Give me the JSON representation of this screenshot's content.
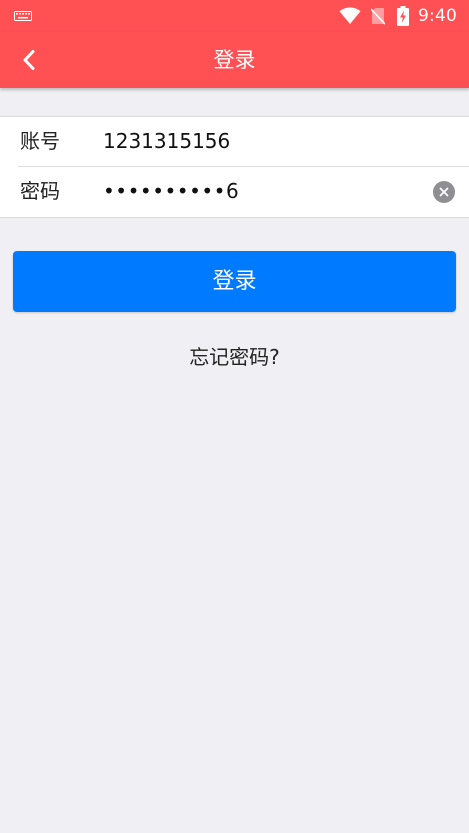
{
  "status_bar": {
    "time": "9:40",
    "icons": [
      "keyboard-icon",
      "wifi-icon",
      "no-sim-icon",
      "battery-charging-icon"
    ]
  },
  "app_bar": {
    "back_icon": "chevron-left-icon",
    "title": "登录"
  },
  "form": {
    "account": {
      "label": "账号",
      "value": "1231315156"
    },
    "password": {
      "label": "密码",
      "value": "••••••••••6",
      "clear_icon": "clear-icon"
    }
  },
  "login_button": {
    "label": "登录"
  },
  "forgot_password": {
    "label": "忘记密码?"
  },
  "colors": {
    "header": "#ff5054",
    "primary_button": "#007aff",
    "background": "#efeff4"
  }
}
